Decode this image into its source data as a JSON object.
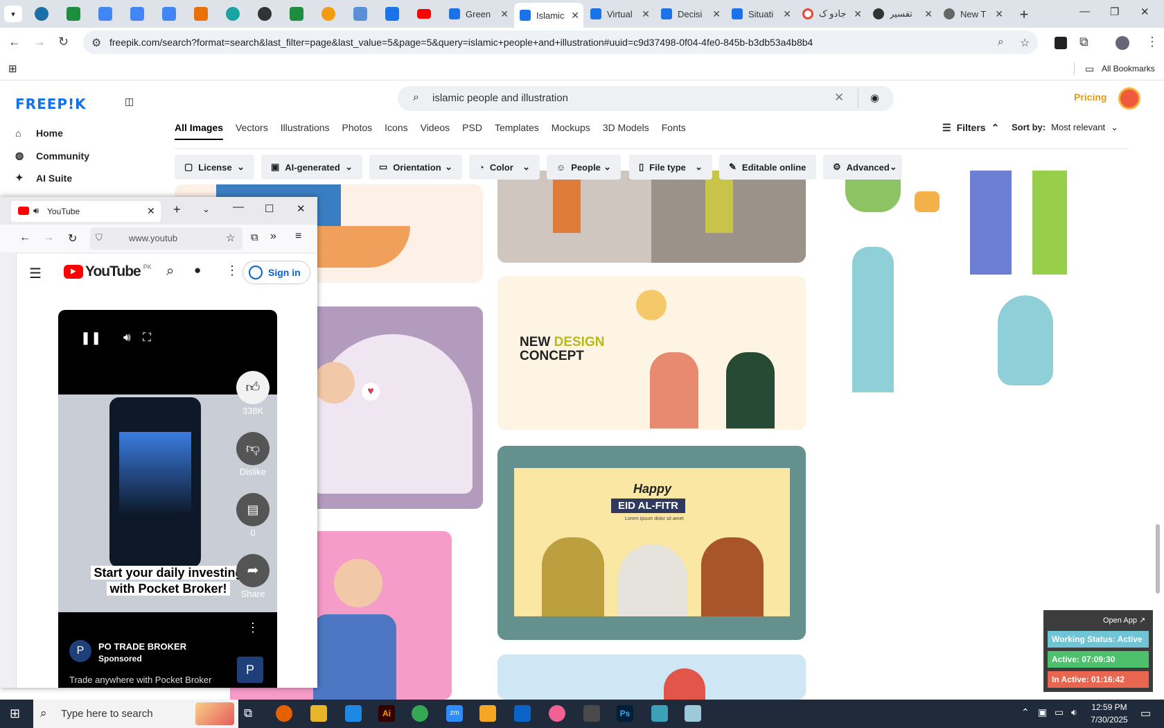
{
  "browser": {
    "tabs": [
      {
        "title": "Green",
        "color": "#1a73e8"
      },
      {
        "title": "Islamic",
        "color": "#1a73e8"
      },
      {
        "title": "Virtual",
        "color": "#1a73e8"
      },
      {
        "title": "Decisi",
        "color": "#1a73e8"
      },
      {
        "title": "Situati",
        "color": "#1a73e8"
      },
      {
        "title": "جادو ک",
        "color": "#ea4335"
      },
      {
        "title": "تفسیر",
        "color": "#333333"
      },
      {
        "title": "New T",
        "color": "#666666"
      }
    ],
    "url": "freepik.com/search?format=search&last_filter=page&last_value=5&page=5&query=islamic+people+and+illustration#uuid=c9d37498-0f04-4fe0-845b-b3db53a4b8b4",
    "bookmarks_label": "All Bookmarks"
  },
  "freepik": {
    "logo": "FREEP!K",
    "sidebar": [
      {
        "label": "Home",
        "icon": "home-icon"
      },
      {
        "label": "Community",
        "icon": "globe-icon"
      },
      {
        "label": "AI Suite",
        "icon": "sparkle-icon"
      }
    ],
    "search_query": "islamic people and illustration",
    "pricing": "Pricing",
    "type_tabs": [
      "All Images",
      "Vectors",
      "Illustrations",
      "Photos",
      "Icons",
      "Videos",
      "PSD",
      "Templates",
      "Mockups",
      "3D Models",
      "Fonts"
    ],
    "filters_label": "Filters",
    "sort_label": "Sort by:",
    "sort_value": "Most relevant",
    "chips": [
      "License",
      "AI-generated",
      "Orientation",
      "Color",
      "People",
      "File type",
      "Editable online",
      "Advanced"
    ],
    "new_design": {
      "title_a": "NEW ",
      "title_b": "DESIGN",
      "title_c": "CONCEPT"
    },
    "eid": {
      "happy": "Happy",
      "title": "EID AL-FITR",
      "sub": "Lorem ipsum dolor sit amet"
    }
  },
  "youtube": {
    "tab_title": "YouTube",
    "url": "www.youtub",
    "brand": "YouTube",
    "region": "PK",
    "sign_in": "Sign in",
    "likes": "338K",
    "dislike": "Dislike",
    "comments": "0",
    "share": "Share",
    "caption_line1": "Start your daily investing",
    "caption_line2": "with Pocket Broker!",
    "channel": "PO TRADE BROKER",
    "sponsored": "Sponsored",
    "desc": "Trade anywhere with Pocket Broker",
    "avatar_letter": "P"
  },
  "status_widget": {
    "open_app": "Open App ↗",
    "working": "Working Status: Active",
    "active": "Active: 07:09:30",
    "inactive": "In Active: 01:16:42",
    "colors": {
      "working": "#6fc4d6",
      "active": "#4cc06a",
      "inactive": "#e8654f"
    }
  },
  "taskbar": {
    "search_placeholder": "Type here to search",
    "time": "12:59 PM",
    "date": "7/30/2025"
  }
}
